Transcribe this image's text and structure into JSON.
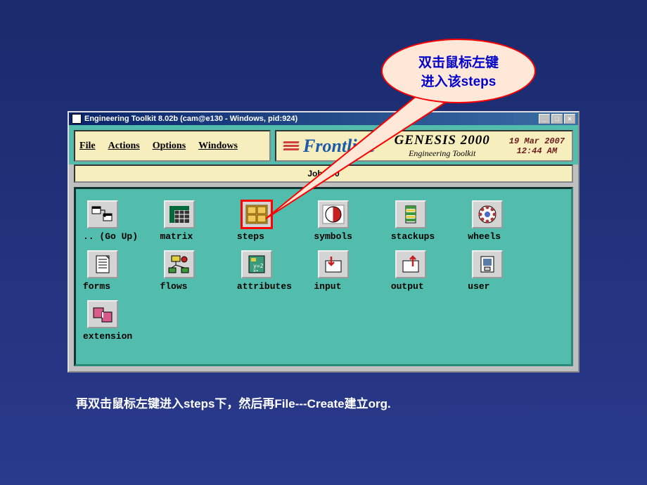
{
  "callout": {
    "line1": "双击鼠标左键",
    "line2": "进入该steps"
  },
  "window": {
    "title": "Engineering Toolkit 8.02b (cam@e130 - Windows, pid:924)"
  },
  "menubar": {
    "file": "File",
    "actions": "Actions",
    "options": "Options",
    "windows": "Windows"
  },
  "logo": {
    "brand": "Frontline",
    "product": "GENESIS 2000",
    "subtitle": "Engineering Toolkit"
  },
  "datetime": {
    "date": "19 Mar 2007",
    "time": "12:44 AM"
  },
  "jobbar": "Job : 00",
  "icons": {
    "goup": ".. (Go Up)",
    "matrix": "matrix",
    "steps": "steps",
    "symbols": "symbols",
    "stackups": "stackups",
    "wheels": "wheels",
    "forms": "forms",
    "flows": "flows",
    "attributes": "attributes",
    "input": "input",
    "output": "output",
    "user": "user",
    "extension": "extension"
  },
  "caption": "再双击鼠标左键进入steps下，然后再File---Create建立org."
}
